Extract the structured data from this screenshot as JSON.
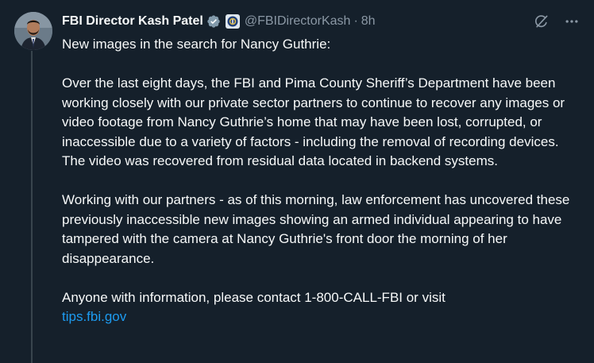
{
  "post": {
    "author_name": "FBI Director Kash Patel",
    "handle": "@FBIDirectorKash",
    "separator": "·",
    "time": "8h",
    "verified_icon": "verified-badge-icon",
    "affiliate_icon": "fbi-seal-icon",
    "body": {
      "intro": "New images in the search for Nancy Guthrie:",
      "para1": "Over the last eight days, the FBI and Pima County Sheriff’s Department have been working closely with our private sector partners to continue to recover any images or video footage from Nancy Guthrie’s home that may have been lost, corrupted, or inaccessible due to a variety of factors - including the removal of recording devices. The video was recovered from residual data located in backend systems.",
      "para2": "Working with our partners - as of this morning, law enforcement has uncovered these previously inaccessible new images showing an armed individual appearing to have tampered with the camera at Nancy Guthrie's front door the morning of her disappearance.",
      "para3": "Anyone with information, please contact 1-800-CALL-FBI or visit",
      "link": "tips.fbi.gov"
    }
  },
  "colors": {
    "background": "#15202b",
    "text": "#f7f9f9",
    "secondary": "#8b98a5",
    "link": "#1d9bf0",
    "verified": "#829aab"
  }
}
